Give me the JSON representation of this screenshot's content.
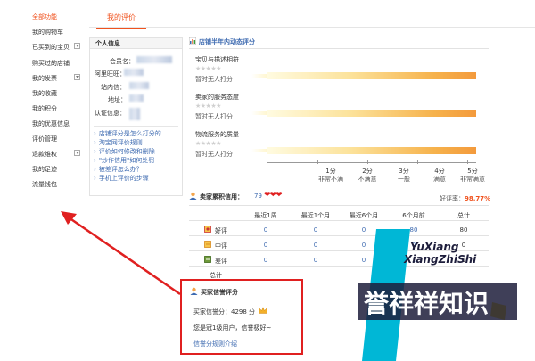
{
  "nav": {
    "items": [
      {
        "label": "全部功能",
        "active": true,
        "arrow": false
      },
      {
        "label": "我的购物车",
        "active": false,
        "arrow": false
      },
      {
        "label": "已买到的宝贝",
        "active": false,
        "arrow": true
      },
      {
        "label": "购买过的店铺",
        "active": false,
        "arrow": false
      },
      {
        "label": "我的发票",
        "active": false,
        "arrow": true
      },
      {
        "label": "我的收藏",
        "active": false,
        "arrow": false
      },
      {
        "label": "我的积分",
        "active": false,
        "arrow": false
      },
      {
        "label": "我的优惠信息",
        "active": false,
        "arrow": false
      },
      {
        "label": "评价管理",
        "active": false,
        "arrow": false
      },
      {
        "label": "退款维权",
        "active": false,
        "arrow": true
      },
      {
        "label": "我的足迹",
        "active": false,
        "arrow": false
      },
      {
        "label": "流量钱包",
        "active": false,
        "arrow": false
      }
    ]
  },
  "tab": {
    "label": "我的评价"
  },
  "info": {
    "title": "个人信息",
    "rows": [
      {
        "label": "会员名："
      },
      {
        "label": "阿里旺旺："
      },
      {
        "label": "站内信："
      },
      {
        "label": "地址："
      },
      {
        "label": "认证信息："
      }
    ],
    "help": [
      "店铺评分是怎么打分的...",
      "淘宝网评价规则",
      "评价如何修改和删除",
      "\"炒作信用\"如何处罚",
      "被差评怎么办？",
      "手机上评价的步骤"
    ]
  },
  "dynamic": {
    "title": "店铺半年内动态评分",
    "categories": [
      {
        "name": "宝贝与描述相符",
        "status": "暂时无人打分"
      },
      {
        "name": "卖家的服务态度",
        "status": "暂时无人打分"
      },
      {
        "name": "物流服务的质量",
        "status": "暂时无人打分"
      }
    ],
    "stars": "★★★★★",
    "scale": [
      {
        "num": "1分",
        "label": "非常不满"
      },
      {
        "num": "2分",
        "label": "不满意"
      },
      {
        "num": "3分",
        "label": "一般"
      },
      {
        "num": "4分",
        "label": "满意"
      },
      {
        "num": "5分",
        "label": "非常满意"
      }
    ]
  },
  "credit": {
    "title": "卖家累积信用：",
    "score": "79",
    "hearts": "❤❤❤",
    "good_rate_label": "好评率：",
    "good_rate": "98.77%",
    "headers": [
      "最近1周",
      "最近1个月",
      "最近6个月",
      "6个月前",
      "总计"
    ],
    "rows": [
      {
        "label": "好评",
        "values": [
          "0",
          "0",
          "0",
          "80",
          "80"
        ]
      },
      {
        "label": "中评",
        "values": [
          "0",
          "0",
          "0",
          "0",
          "0"
        ]
      },
      {
        "label": "差评",
        "values": [
          "0",
          "0",
          "0",
          "1",
          "1"
        ]
      },
      {
        "label": "总计",
        "values": [
          "",
          "",
          "",
          "",
          ""
        ]
      }
    ]
  },
  "buyer": {
    "title": "买家信誉评分",
    "score_label": "买家信誉分：",
    "score": "4298 分",
    "level_text": "您是冠1级用户，信誉极好~",
    "link": "信誉分规则介绍"
  },
  "watermark": {
    "pinyin1": "YuXiang",
    "pinyin2": "XiangZhiShi",
    "cn": "誉祥祥知识"
  },
  "colors": {
    "accent": "#f0521e",
    "link": "#3d6ab0",
    "annotation": "#e02020",
    "watermark_cyan": "#00b7d6"
  }
}
